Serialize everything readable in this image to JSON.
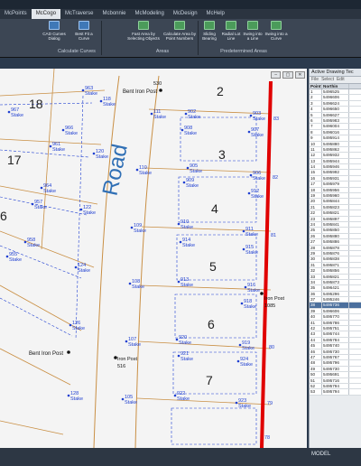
{
  "ribbon": {
    "tabs": [
      "McPoints",
      "McCogo",
      "McTraverse",
      "Mcbonnie",
      "McModeling",
      "McDesign",
      "McHelp"
    ],
    "active_tab": "McCogo",
    "buttons": [
      {
        "label": "CAD Curves Dialog",
        "icon": "curve-dialog-icon"
      },
      {
        "label": "Best Fit a Curve",
        "icon": "best-fit-icon"
      },
      {
        "label": "Fast Area by Selecting Objects",
        "icon": "fast-area-icon"
      },
      {
        "label": "Calculate Area by Point Numbers",
        "icon": "area-points-icon"
      },
      {
        "label": "Sliding Bearing",
        "icon": "sliding-bearing-icon"
      },
      {
        "label": "Radial Lot Line",
        "icon": "radial-lot-icon"
      },
      {
        "label": "Swing into a Line",
        "icon": "swing-line-icon"
      },
      {
        "label": "Swing into a Curve",
        "icon": "swing-curve-icon"
      }
    ],
    "groups": [
      "Calculate Curves",
      "Areas",
      "Predetermined Areas"
    ]
  },
  "drawing": {
    "road_label": "Road",
    "lots": [
      {
        "number": "18"
      },
      {
        "number": "17"
      },
      {
        "number": "6"
      },
      {
        "number": "2"
      },
      {
        "number": "3"
      },
      {
        "number": "4"
      },
      {
        "number": "5"
      },
      {
        "number": "6"
      },
      {
        "number": "7"
      }
    ],
    "points": [
      {
        "num": "963",
        "label": "Stake"
      },
      {
        "num": "118",
        "label": "Stake"
      },
      {
        "num": "967",
        "label": "Stake"
      },
      {
        "num": "966",
        "label": "Stake"
      },
      {
        "num": "961",
        "label": "Stake"
      },
      {
        "num": "120",
        "label": "Stake"
      },
      {
        "num": "964",
        "label": "Stake"
      },
      {
        "num": "957",
        "label": "Stake"
      },
      {
        "num": "122",
        "label": "Stake"
      },
      {
        "num": "958",
        "label": "Stake"
      },
      {
        "num": "955",
        "label": "Stake"
      },
      {
        "num": "124",
        "label": "Stake"
      },
      {
        "num": "126",
        "label": "Stake"
      },
      {
        "num": "128",
        "label": "Stake"
      },
      {
        "num": "111",
        "label": "Stake"
      },
      {
        "num": "902",
        "label": "Stake"
      },
      {
        "num": "903",
        "label": "Stake"
      },
      {
        "num": "908",
        "label": "Stake"
      },
      {
        "num": "907",
        "label": "Stake"
      },
      {
        "num": "110",
        "label": "Stake"
      },
      {
        "num": "905",
        "label": "Stake"
      },
      {
        "num": "906",
        "label": "Stake"
      },
      {
        "num": "909",
        "label": "Stake"
      },
      {
        "num": "912",
        "label": "Stake"
      },
      {
        "num": "109",
        "label": "Stake"
      },
      {
        "num": "910",
        "label": "Stake"
      },
      {
        "num": "911",
        "label": "Stake"
      },
      {
        "num": "914",
        "label": "Stake"
      },
      {
        "num": "915",
        "label": "Stake"
      },
      {
        "num": "108",
        "label": "Stake"
      },
      {
        "num": "913",
        "label": "Stake"
      },
      {
        "num": "916",
        "label": "Stake"
      },
      {
        "num": "918",
        "label": "Stake"
      },
      {
        "num": "107",
        "label": "Stake"
      },
      {
        "num": "920",
        "label": "Stake"
      },
      {
        "num": "919",
        "label": "Stake"
      },
      {
        "num": "921",
        "label": "Stake"
      },
      {
        "num": "924",
        "label": "Stake"
      },
      {
        "num": "105",
        "label": "Stake"
      },
      {
        "num": "922",
        "label": "Stake"
      },
      {
        "num": "923",
        "label": "Stake"
      }
    ],
    "posts": [
      {
        "label": "Bent Iron Post",
        "num": "530"
      },
      {
        "label": "Bent Iron Post",
        "num": ""
      },
      {
        "label": "Iron Post",
        "num": "516"
      },
      {
        "label": "Iron Post",
        "num": "1085"
      }
    ],
    "edge_labels": [
      "83",
      "82",
      "81",
      "80",
      "79",
      "78"
    ]
  },
  "panel": {
    "title": "Active Drawing Tec",
    "menu": [
      "File",
      "Select",
      "Edit"
    ],
    "columns": [
      "Point",
      "Northin"
    ],
    "rows": [
      [
        "1",
        "5496525"
      ],
      [
        "2",
        "5496606"
      ],
      [
        "3",
        "5496624"
      ],
      [
        "4",
        "5496650"
      ],
      [
        "5",
        "5496627"
      ],
      [
        "6",
        "5495983"
      ],
      [
        "7",
        "5496004"
      ],
      [
        "8",
        "5496016"
      ],
      [
        "9",
        "5495914"
      ],
      [
        "10",
        "5495880"
      ],
      [
        "11",
        "5495862"
      ],
      [
        "12",
        "5495932"
      ],
      [
        "13",
        "5495944"
      ],
      [
        "14",
        "5495946"
      ],
      [
        "15",
        "5495992"
      ],
      [
        "16",
        "5495931"
      ],
      [
        "17",
        "5495979"
      ],
      [
        "18",
        "5495956"
      ],
      [
        "19",
        "5495960"
      ],
      [
        "20",
        "5495844"
      ],
      [
        "21",
        "5495823"
      ],
      [
        "22",
        "5495821"
      ],
      [
        "23",
        "5495897"
      ],
      [
        "24",
        "5495841"
      ],
      [
        "25",
        "5495850"
      ],
      [
        "26",
        "5495880"
      ],
      [
        "27",
        "5495886"
      ],
      [
        "28",
        "5495878"
      ],
      [
        "29",
        "5495876"
      ],
      [
        "30",
        "5495838"
      ],
      [
        "31",
        "5495871"
      ],
      [
        "32",
        "5495856"
      ],
      [
        "33",
        "5495821"
      ],
      [
        "34",
        "5495873"
      ],
      [
        "35",
        "5496421"
      ],
      [
        "36",
        "5495296"
      ],
      [
        "37",
        "5495246"
      ],
      [
        "38",
        "5495736"
      ],
      [
        "39",
        "5496606"
      ],
      [
        "40",
        "5495770"
      ],
      [
        "41",
        "5495786"
      ],
      [
        "42",
        "5495751"
      ],
      [
        "43",
        "5495744"
      ],
      [
        "44",
        "5495784"
      ],
      [
        "45",
        "5495740"
      ],
      [
        "46",
        "5495730"
      ],
      [
        "47",
        "5495767"
      ],
      [
        "48",
        "5495796"
      ],
      [
        "49",
        "5495730"
      ],
      [
        "50",
        "5495691"
      ],
      [
        "51",
        "5495716"
      ],
      [
        "52",
        "5495794"
      ],
      [
        "53",
        "5495794"
      ]
    ],
    "selected_row": 37
  },
  "status": {
    "model_label": "MODEL"
  }
}
